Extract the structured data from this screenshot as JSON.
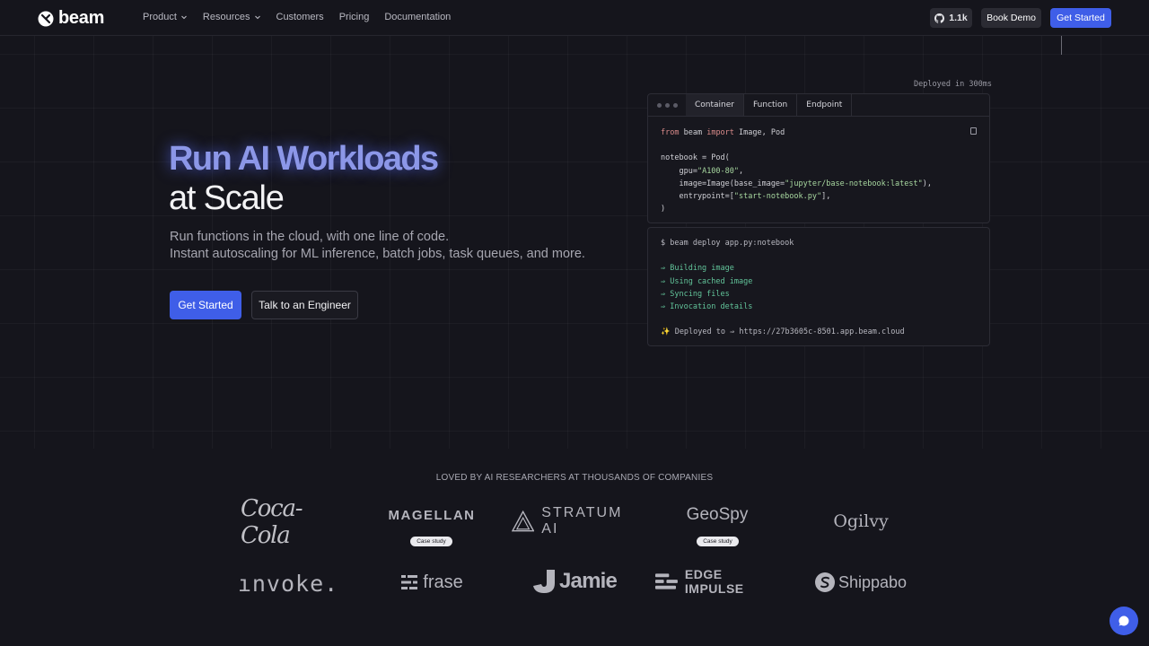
{
  "nav": {
    "logo_text": "beam",
    "links": [
      "Product",
      "Resources",
      "Customers",
      "Pricing",
      "Documentation"
    ],
    "github_stars": "1.1k",
    "book_demo": "Book Demo",
    "get_started": "Get Started"
  },
  "hero": {
    "title_line1": "Run AI Workloads",
    "title_line2": "at Scale",
    "subtitle_line1": "Run functions in the cloud, with one line of code.",
    "subtitle_line2": "Instant autoscaling for ML inference, batch jobs, task queues, and more.",
    "cta_primary": "Get Started",
    "cta_secondary": "Talk to an Engineer"
  },
  "code_panel": {
    "deployed_label": "Deployed in 300ms",
    "tabs": [
      "Container",
      "Function",
      "Endpoint"
    ],
    "active_tab": "Container"
  },
  "terminal": {
    "command": "$ beam deploy app.py:notebook",
    "steps": [
      "⇒ Building image",
      "⇒ Using cached image",
      "⇒ Syncing files",
      "⇒ Invocation details"
    ],
    "deployed_line": "✨ Deployed to ⇒ https://27b3605c-8501.app.beam.cloud"
  },
  "customers": {
    "heading": "LOVED BY AI RESEARCHERS AT THOUSANDS OF COMPANIES",
    "row1": [
      "Coca-Cola",
      "MAGELLAN",
      "STRATUM AI",
      "GeoSpy",
      "Ogilvy"
    ],
    "row2": [
      "ınvoke.",
      "frase",
      "Jamie",
      "EDGE IMPULSE",
      "Shippabo"
    ],
    "case_study_label": "Case study"
  },
  "colors": {
    "background": "#15151c",
    "accent": "#3f5ee8",
    "title_glow": "#8c97e8",
    "terminal_green": "#62c49a"
  }
}
